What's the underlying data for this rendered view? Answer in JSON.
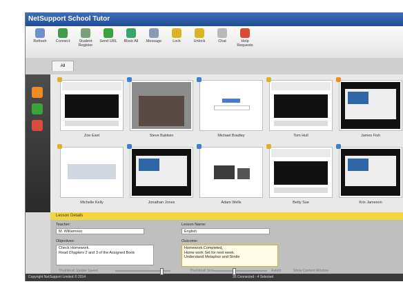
{
  "window": {
    "title": "NetSupport School Tutor"
  },
  "toolbar": [
    {
      "label": "Refresh",
      "icon": "refresh-icon",
      "color": "#6b8fcf"
    },
    {
      "label": "Connect",
      "icon": "connect-icon",
      "color": "#3f9d4a"
    },
    {
      "label": "Student Register",
      "icon": "register-icon",
      "color": "#7aa07a"
    },
    {
      "label": "Send URL",
      "icon": "send-url-icon",
      "color": "#3aa33a"
    },
    {
      "label": "Block All",
      "icon": "block-all-icon",
      "color": "#36a66b"
    },
    {
      "label": "Message",
      "icon": "message-icon",
      "color": "#8a9ab5"
    },
    {
      "label": "Lock",
      "icon": "lock-icon",
      "color": "#d8b426"
    },
    {
      "label": "Unlock",
      "icon": "unlock-icon",
      "color": "#d8b426"
    },
    {
      "label": "Chat",
      "icon": "chat-icon",
      "color": "#b9b9b9"
    },
    {
      "label": "Help Requests",
      "icon": "help-icon",
      "color": "#d94b3b"
    }
  ],
  "tabs": {
    "all": "All"
  },
  "sidebar": [
    {
      "icon": "students-view-icon",
      "color": "#f08a24"
    },
    {
      "icon": "web-icon",
      "color": "#3aa33a"
    },
    {
      "icon": "apps-icon",
      "color": "#d94b3b"
    }
  ],
  "students": [
    {
      "name": "Zoe East",
      "badge": "#e0b02c",
      "screen": "dark"
    },
    {
      "name": "Steve Baldwin",
      "badge": "#3d7fd4",
      "screen": "photo"
    },
    {
      "name": "Michael Bradley",
      "badge": "#3d7fd4",
      "screen": "google"
    },
    {
      "name": "Tom Hull",
      "badge": "#e0b02c",
      "screen": "dark"
    },
    {
      "name": "James Fish",
      "badge": "#f08a24",
      "screen": "black"
    },
    {
      "name": "Michelle Kelly",
      "badge": "#e0b02c",
      "screen": "white"
    },
    {
      "name": "Jonathan Jones",
      "badge": "#3d7fd4",
      "screen": "black"
    },
    {
      "name": "Adam Wells",
      "badge": "#3d7fd4",
      "screen": "devices"
    },
    {
      "name": "Betty Sue",
      "badge": "#e0b02c",
      "screen": "dark"
    },
    {
      "name": "Kris Jameson",
      "badge": "#3d7fd4",
      "screen": "black"
    }
  ],
  "lesson": {
    "header": "Lesson Details",
    "teacher_label": "Teacher:",
    "teacher_value": "M. Williamson",
    "lesson_name_label": "Lesson Name:",
    "lesson_name_value": "English",
    "objectives_label": "Objectives:",
    "objectives_value": [
      "Check Homework.",
      "Read Chapters 2 and 3 of the Assigned Book"
    ],
    "outcomes_label": "Outcome:",
    "outcomes_value": [
      "Homework Completed.",
      "Home work Set for next week.",
      "Understand Metaphor and Simile"
    ]
  },
  "statusbar": {
    "copyright": "Copyright NetSupport Limited © 2014",
    "thumb_speed": "Thumbnail Update Speed",
    "thumb_size": "Thumbnail Size",
    "autofit": "Autofit",
    "show_content": "Show Content Window",
    "connected": "35 Connected - 4 Selected"
  }
}
